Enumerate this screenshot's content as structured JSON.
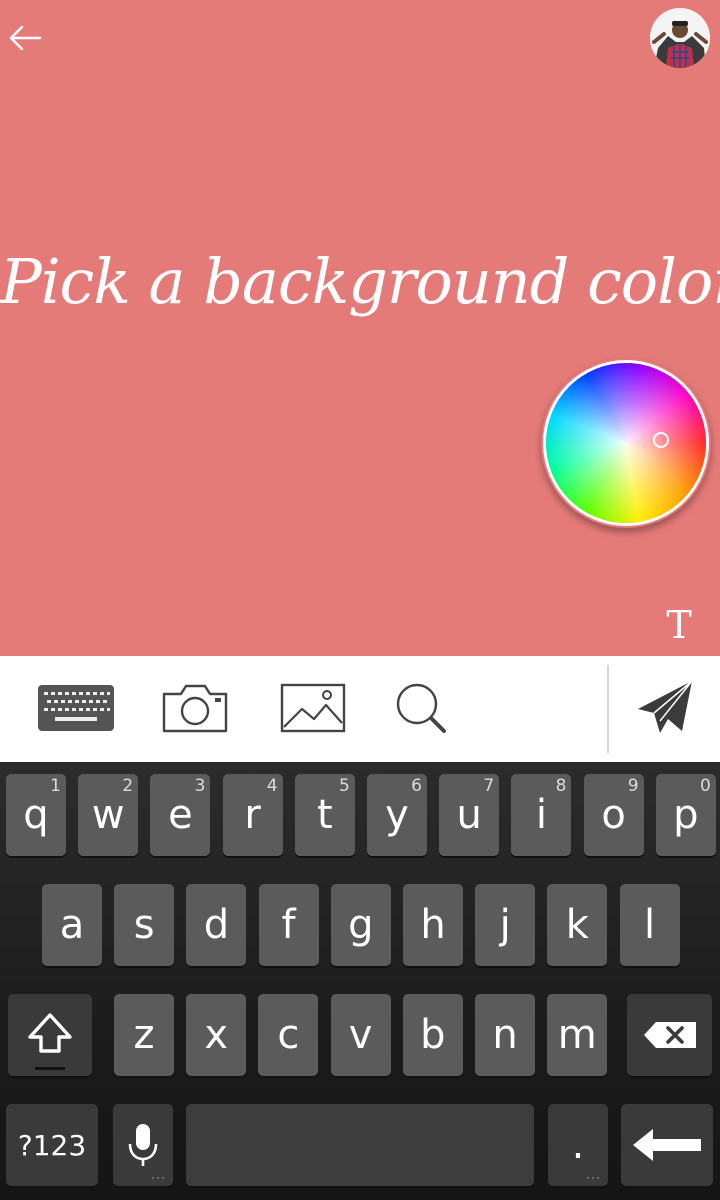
{
  "canvas": {
    "background_color": "#e57b79",
    "prompt": "Pick a background color",
    "text_tool_label": "T"
  },
  "icons": {
    "back": "arrow-left-icon",
    "avatar": "user-avatar",
    "keyboard": "keyboard-icon",
    "camera": "camera-icon",
    "gallery": "image-icon",
    "search": "search-icon",
    "send": "send-icon",
    "shift": "shift-arrow-icon",
    "backspace": "backspace-icon",
    "mic": "microphone-icon",
    "enter": "enter-arrow-icon"
  },
  "keyboard": {
    "row1": [
      {
        "label": "q",
        "hint": "1"
      },
      {
        "label": "w",
        "hint": "2"
      },
      {
        "label": "e",
        "hint": "3"
      },
      {
        "label": "r",
        "hint": "4"
      },
      {
        "label": "t",
        "hint": "5"
      },
      {
        "label": "y",
        "hint": "6"
      },
      {
        "label": "u",
        "hint": "7"
      },
      {
        "label": "i",
        "hint": "8"
      },
      {
        "label": "o",
        "hint": "9"
      },
      {
        "label": "p",
        "hint": "0"
      }
    ],
    "row2": [
      "a",
      "s",
      "d",
      "f",
      "g",
      "h",
      "j",
      "k",
      "l"
    ],
    "row3": [
      "z",
      "x",
      "c",
      "v",
      "b",
      "n",
      "m"
    ],
    "symbols_label": "?123",
    "period_label": ".",
    "more_dots": "···"
  }
}
